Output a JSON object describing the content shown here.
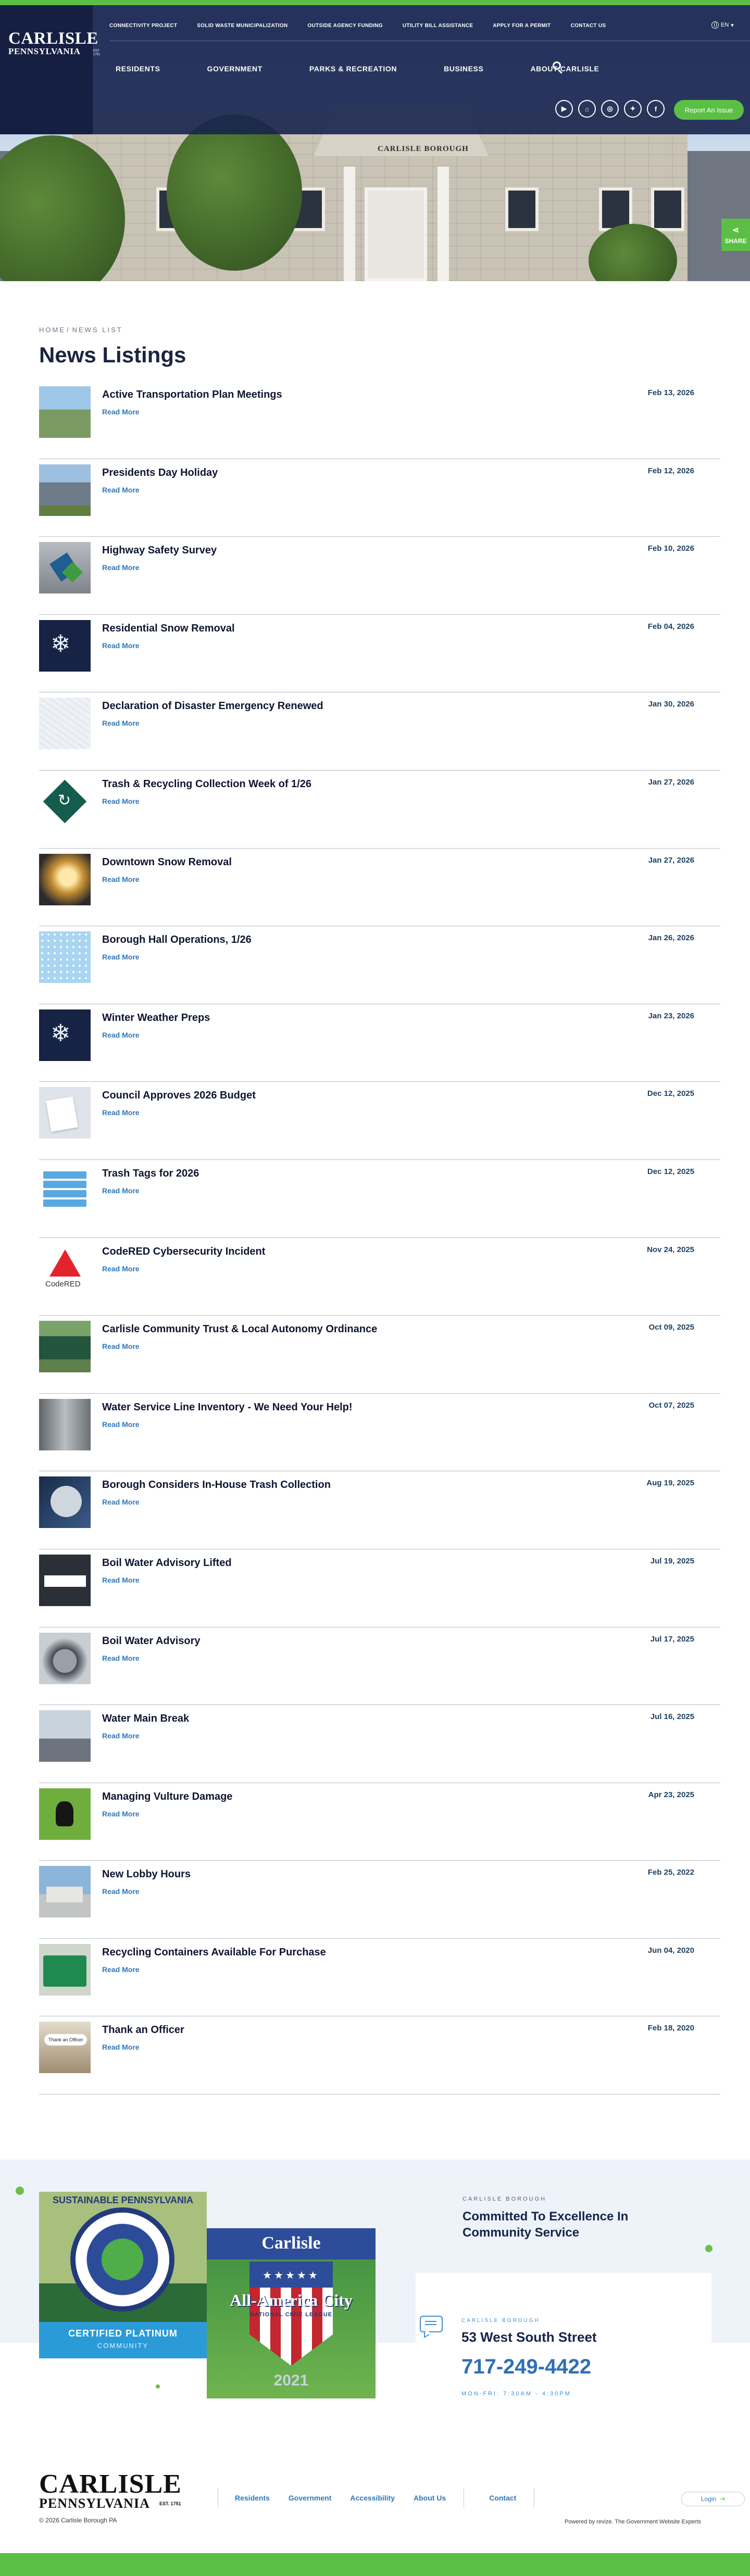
{
  "logo": {
    "line1": "CARLISLE",
    "line2": "PENNSYLVANIA",
    "est": "EST. 1751"
  },
  "utility_nav": [
    "CONNECTIVITY PROJECT",
    "SOLID WASTE MUNICIPALIZATION",
    "OUTSIDE AGENCY FUNDING",
    "UTILITY BILL ASSISTANCE",
    "APPLY FOR A PERMIT",
    "CONTACT US"
  ],
  "language": "EN",
  "main_nav": [
    "RESIDENTS",
    "GOVERNMENT",
    "PARKS & RECREATION",
    "BUSINESS",
    "ABOUT CARLISLE"
  ],
  "socials": [
    {
      "icon": "youtube-icon",
      "glyph": "▶"
    },
    {
      "icon": "nextdoor-icon",
      "glyph": "⌂"
    },
    {
      "icon": "instagram-icon",
      "glyph": "◎"
    },
    {
      "icon": "twitter-icon",
      "glyph": "✦"
    },
    {
      "icon": "facebook-icon",
      "glyph": "f"
    }
  ],
  "report_button": "Report An Issue",
  "hero_sign": "CARLISLE BOROUGH",
  "share_label": "SHARE",
  "breadcrumb": {
    "home": "HOME",
    "sep": "/",
    "current": "NEWS LIST"
  },
  "page_title": "News Listings",
  "read_more_label": "Read More",
  "news": [
    {
      "title": "Active Transportation Plan Meetings",
      "date": "Feb 13, 2026",
      "thumb": "sky"
    },
    {
      "title": "Presidents Day Holiday",
      "date": "Feb 12, 2026",
      "thumb": "house"
    },
    {
      "title": "Highway Safety Survey",
      "date": "Feb 10, 2026",
      "thumb": "hwy"
    },
    {
      "title": "Residential Snow Removal",
      "date": "Feb 04, 2026",
      "thumb": "snow"
    },
    {
      "title": "Declaration of Disaster Emergency Renewed",
      "date": "Jan 30, 2026",
      "thumb": "snow-light"
    },
    {
      "title": "Trash & Recycling Collection Week of 1/26",
      "date": "Jan 27, 2026",
      "thumb": "diamond"
    },
    {
      "title": "Downtown Snow Removal",
      "date": "Jan 27, 2026",
      "thumb": "glow"
    },
    {
      "title": "Borough Hall Operations, 1/26",
      "date": "Jan 26, 2026",
      "thumb": "bluesnow"
    },
    {
      "title": "Winter Weather Preps",
      "date": "Jan 23, 2026",
      "thumb": "snow"
    },
    {
      "title": "Council Approves 2026 Budget",
      "date": "Dec 12, 2025",
      "thumb": "paper"
    },
    {
      "title": "Trash Tags for 2026",
      "date": "Dec 12, 2025",
      "thumb": "tags"
    },
    {
      "title": "CodeRED Cybersecurity Incident",
      "date": "Nov 24, 2025",
      "thumb": "codered"
    },
    {
      "title": "Carlisle Community Trust & Local Autonomy  Ordinance",
      "date": "Oct 09, 2025",
      "thumb": "sign"
    },
    {
      "title": "Water Service Line Inventory - We Need Your Help!",
      "date": "Oct 07, 2025",
      "thumb": "pipe"
    },
    {
      "title": "Borough Considers In-House Trash Collection",
      "date": "Aug 19, 2025",
      "thumb": "can"
    },
    {
      "title": "Boil Water Advisory Lifted",
      "date": "Jul 19, 2025",
      "thumb": "boil"
    },
    {
      "title": "Boil Water Advisory",
      "date": "Jul 17, 2025",
      "thumb": "pot"
    },
    {
      "title": "Water Main Break",
      "date": "Jul 16, 2025",
      "thumb": "worker"
    },
    {
      "title": "Managing Vulture Damage",
      "date": "Apr 23, 2025",
      "thumb": "vulture"
    },
    {
      "title": "New Lobby Hours",
      "date": "Feb 25, 2022",
      "thumb": "lobby"
    },
    {
      "title": "Recycling Containers Available For Purchase",
      "date": "Jun 04, 2020",
      "thumb": "bins"
    },
    {
      "title": "Thank an Officer",
      "date": "Feb 18, 2020",
      "thumb": "officer"
    }
  ],
  "badge1": {
    "top": "SUSTAINABLE PENNSYLVANIA",
    "certified": "CERTIFIED PLATINUM",
    "community": "COMMUNITY"
  },
  "badge2": {
    "name": "Carlisle",
    "title": "All-America City",
    "sub": "NATIONAL CIVIC LEAGUE",
    "year": "2021"
  },
  "info": {
    "label": "CARLISLE BOROUGH",
    "heading": "Committed To Excellence In Community Service",
    "contact_label": "CARLISLE BOROUGH",
    "address": "53 West South Street",
    "phone": "717-249-4422",
    "hours": "MON-FRI: 7:30AM - 4:30PM"
  },
  "footer": {
    "nav": [
      "Residents",
      "Government",
      "Accessibility",
      "About Us",
      "Contact"
    ],
    "login": "Login",
    "copyright": "© 2026 Carlisle Borough PA",
    "powered_prefix": "Powered by",
    "powered_brand": "revize.",
    "powered_suffix": "The Government Website Experts"
  },
  "colors": {
    "navy": "#1b2440",
    "green": "#5bbf46",
    "link_blue": "#2f77b8"
  }
}
